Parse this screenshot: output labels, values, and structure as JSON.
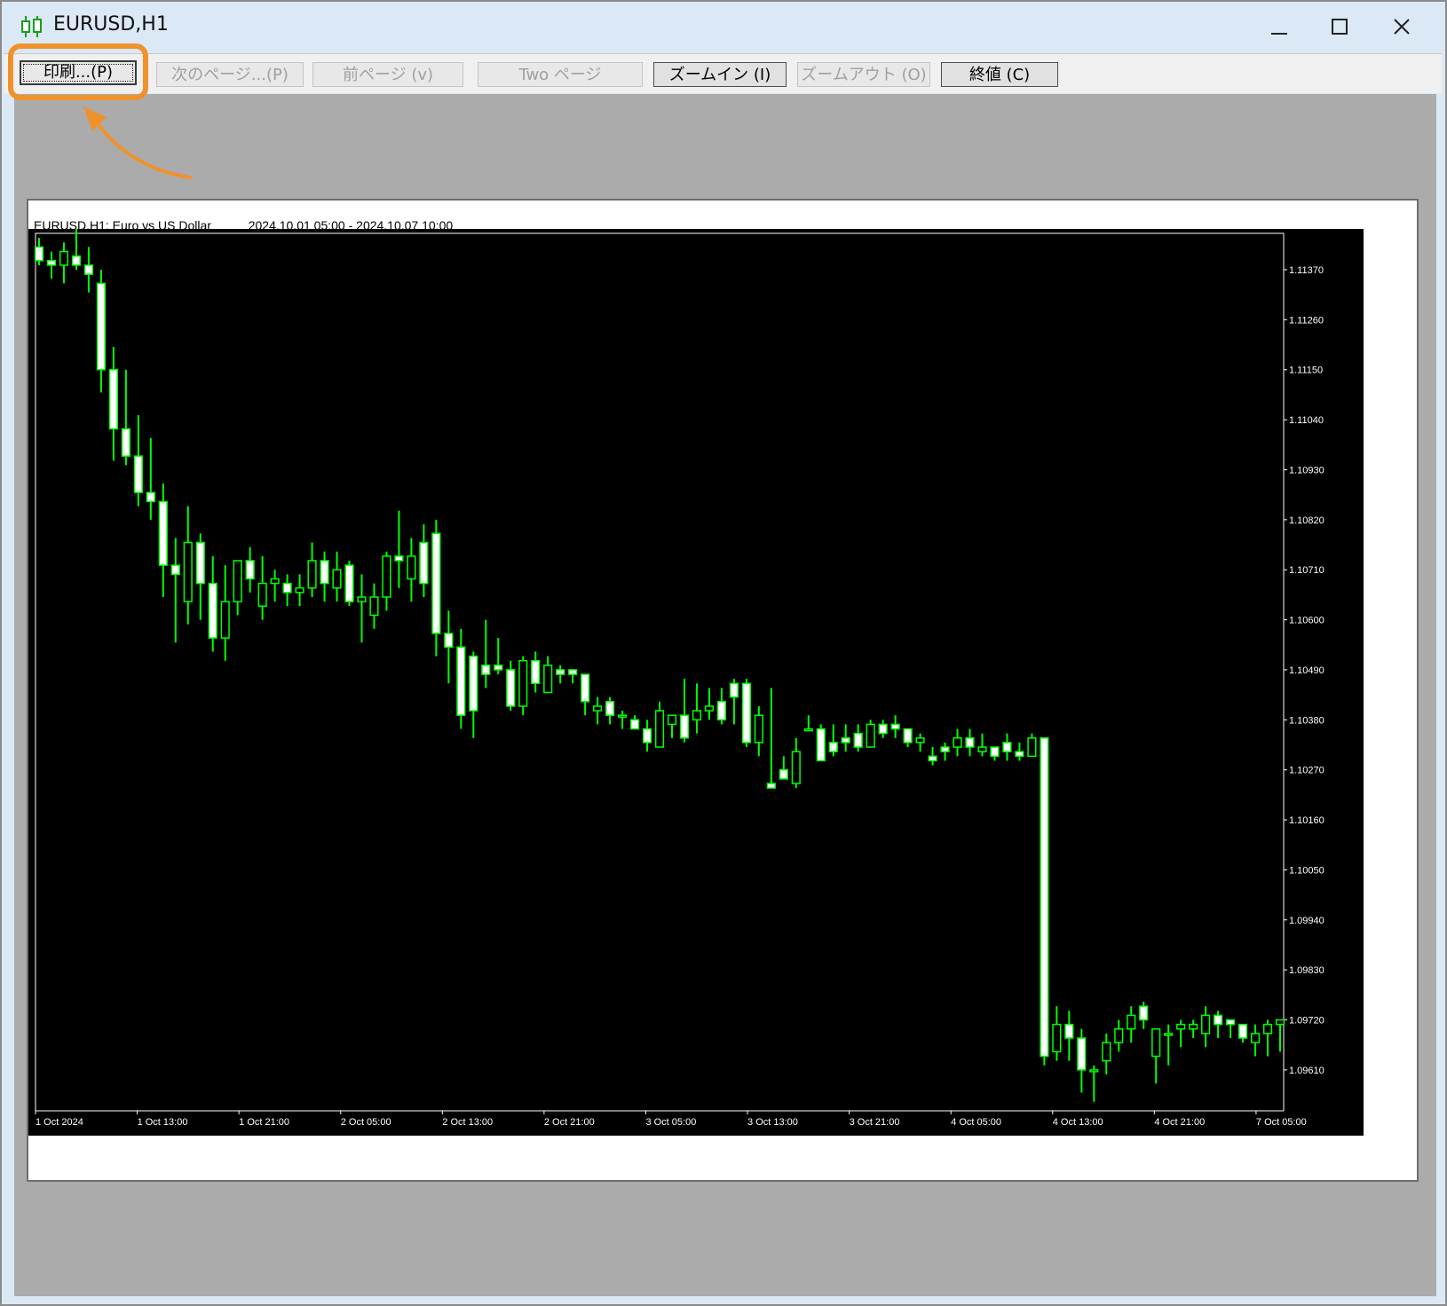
{
  "window": {
    "title": "EURUSD,H1",
    "controls": {
      "minimize": "—",
      "maximize": "☐",
      "close": "✕"
    }
  },
  "toolbar": {
    "buttons": [
      {
        "label": "印刷...(P)",
        "enabled": true,
        "highlighted": true
      },
      {
        "label": "次のページ...(P)",
        "enabled": false
      },
      {
        "label": "前ページ (v)",
        "enabled": false
      },
      {
        "label": "Two ページ",
        "enabled": false
      },
      {
        "label": "ズームイン (I)",
        "enabled": true
      },
      {
        "label": "ズームアウト (O)",
        "enabled": false
      },
      {
        "label": "終値 (C)",
        "enabled": true
      }
    ]
  },
  "chart_header": {
    "symbol_text": "EURUSD,H1:  Euro vs US Dollar",
    "range_text": "2024.10.01 05:00 - 2024.10.07 10:00"
  },
  "colors": {
    "accent_highlight": "#f0922b",
    "chart_bg": "#000000",
    "candle": "#00ff00",
    "bull_body": "#000000",
    "bear_body": "#ffffff"
  },
  "chart_data": {
    "type": "candlestick",
    "symbol": "EURUSD",
    "timeframe": "H1",
    "ylim": [
      1.0952,
      1.1145
    ],
    "y_ticks": [
      "1.11370",
      "1.11260",
      "1.11150",
      "1.11040",
      "1.10930",
      "1.10820",
      "1.10710",
      "1.10600",
      "1.10490",
      "1.10380",
      "1.10270",
      "1.10160",
      "1.10050",
      "1.09940",
      "1.09830",
      "1.09720",
      "1.09610"
    ],
    "x_ticks": [
      "1 Oct 2024",
      "1 Oct 13:00",
      "1 Oct 21:00",
      "2 Oct 05:00",
      "2 Oct 13:00",
      "2 Oct 21:00",
      "3 Oct 05:00",
      "3 Oct 13:00",
      "3 Oct 21:00",
      "4 Oct 05:00",
      "4 Oct 13:00",
      "4 Oct 21:00",
      "7 Oct 05:00"
    ],
    "grid": false,
    "ohlc": [
      [
        1.1142,
        1.1144,
        1.1138,
        1.1139
      ],
      [
        1.1139,
        1.1141,
        1.1135,
        1.1138
      ],
      [
        1.1138,
        1.1143,
        1.1134,
        1.1141
      ],
      [
        1.114,
        1.1146,
        1.1137,
        1.1138
      ],
      [
        1.1138,
        1.1142,
        1.1132,
        1.1136
      ],
      [
        1.1134,
        1.1137,
        1.111,
        1.1115
      ],
      [
        1.1115,
        1.112,
        1.1095,
        1.1102
      ],
      [
        1.1102,
        1.1115,
        1.1094,
        1.1096
      ],
      [
        1.1096,
        1.1105,
        1.1085,
        1.1088
      ],
      [
        1.1088,
        1.11,
        1.1082,
        1.1086
      ],
      [
        1.1086,
        1.109,
        1.1065,
        1.1072
      ],
      [
        1.1072,
        1.1078,
        1.1055,
        1.107
      ],
      [
        1.1064,
        1.1085,
        1.1059,
        1.1077
      ],
      [
        1.1077,
        1.1079,
        1.106,
        1.1068
      ],
      [
        1.1068,
        1.1074,
        1.1053,
        1.1056
      ],
      [
        1.1056,
        1.1072,
        1.1051,
        1.1064
      ],
      [
        1.1064,
        1.1073,
        1.1061,
        1.1073
      ],
      [
        1.1073,
        1.1076,
        1.1066,
        1.1069
      ],
      [
        1.1063,
        1.1074,
        1.106,
        1.1068
      ],
      [
        1.1068,
        1.1071,
        1.1064,
        1.1069
      ],
      [
        1.1068,
        1.107,
        1.1063,
        1.1066
      ],
      [
        1.1066,
        1.107,
        1.1063,
        1.1067
      ],
      [
        1.1067,
        1.1077,
        1.1065,
        1.1073
      ],
      [
        1.1073,
        1.1075,
        1.1064,
        1.1068
      ],
      [
        1.1067,
        1.1075,
        1.1064,
        1.1071
      ],
      [
        1.1072,
        1.1073,
        1.1063,
        1.1064
      ],
      [
        1.1064,
        1.107,
        1.1055,
        1.1065
      ],
      [
        1.1061,
        1.1068,
        1.1058,
        1.1065
      ],
      [
        1.1065,
        1.1075,
        1.1062,
        1.1074
      ],
      [
        1.1074,
        1.1084,
        1.1067,
        1.1073
      ],
      [
        1.1069,
        1.1078,
        1.1064,
        1.1074
      ],
      [
        1.1077,
        1.1081,
        1.1065,
        1.1068
      ],
      [
        1.1079,
        1.1082,
        1.1052,
        1.1057
      ],
      [
        1.1057,
        1.1062,
        1.1046,
        1.1054
      ],
      [
        1.1054,
        1.1058,
        1.1036,
        1.1039
      ],
      [
        1.1052,
        1.1053,
        1.1034,
        1.104
      ],
      [
        1.105,
        1.106,
        1.1045,
        1.1048
      ],
      [
        1.105,
        1.1056,
        1.1048,
        1.1049
      ],
      [
        1.1049,
        1.1051,
        1.104,
        1.1041
      ],
      [
        1.1041,
        1.1052,
        1.1039,
        1.1051
      ],
      [
        1.1051,
        1.1053,
        1.1044,
        1.1046
      ],
      [
        1.1044,
        1.1052,
        1.1044,
        1.105
      ],
      [
        1.1049,
        1.105,
        1.1046,
        1.1048
      ],
      [
        1.1049,
        1.1049,
        1.1046,
        1.1048
      ],
      [
        1.1048,
        1.1048,
        1.1039,
        1.1042
      ],
      [
        1.104,
        1.1043,
        1.1037,
        1.1041
      ],
      [
        1.1042,
        1.1043,
        1.1037,
        1.1039
      ],
      [
        1.1039,
        1.104,
        1.1036,
        1.1039
      ],
      [
        1.1038,
        1.1039,
        1.1036,
        1.1036
      ],
      [
        1.1036,
        1.1038,
        1.1031,
        1.1033
      ],
      [
        1.1032,
        1.1042,
        1.1032,
        1.104
      ],
      [
        1.1037,
        1.1039,
        1.1034,
        1.1039
      ],
      [
        1.1039,
        1.1047,
        1.1033,
        1.1034
      ],
      [
        1.1038,
        1.1046,
        1.1035,
        1.104
      ],
      [
        1.104,
        1.1045,
        1.1038,
        1.1041
      ],
      [
        1.1042,
        1.1045,
        1.1037,
        1.1038
      ],
      [
        1.1046,
        1.1047,
        1.1037,
        1.1043
      ],
      [
        1.1046,
        1.1047,
        1.1032,
        1.1033
      ],
      [
        1.1033,
        1.1041,
        1.103,
        1.1039
      ],
      [
        1.1024,
        1.1045,
        1.1023,
        1.1023
      ],
      [
        1.1027,
        1.103,
        1.1025,
        1.1025
      ],
      [
        1.1024,
        1.1034,
        1.1023,
        1.1031
      ],
      [
        1.1036,
        1.1039,
        1.1036,
        1.1036
      ],
      [
        1.1036,
        1.1037,
        1.103,
        1.1029
      ],
      [
        1.1033,
        1.1037,
        1.103,
        1.1031
      ],
      [
        1.1034,
        1.1037,
        1.1031,
        1.1033
      ],
      [
        1.1035,
        1.1037,
        1.1031,
        1.1032
      ],
      [
        1.1032,
        1.1038,
        1.1036,
        1.1037
      ],
      [
        1.1037,
        1.1038,
        1.1034,
        1.1035
      ],
      [
        1.1037,
        1.1039,
        1.1034,
        1.1036
      ],
      [
        1.1036,
        1.1036,
        1.1032,
        1.1033
      ],
      [
        1.1033,
        1.1035,
        1.1031,
        1.1034
      ],
      [
        1.103,
        1.1032,
        1.1028,
        1.1029
      ],
      [
        1.1032,
        1.1033,
        1.1029,
        1.1031
      ],
      [
        1.1032,
        1.1036,
        1.103,
        1.1034
      ],
      [
        1.1034,
        1.1036,
        1.103,
        1.1032
      ],
      [
        1.1031,
        1.1035,
        1.103,
        1.1032
      ],
      [
        1.1032,
        1.1032,
        1.1029,
        1.103
      ],
      [
        1.1033,
        1.1035,
        1.1029,
        1.1031
      ],
      [
        1.1031,
        1.1033,
        1.1029,
        1.103
      ],
      [
        1.103,
        1.1035,
        1.103,
        1.1034
      ],
      [
        1.1034,
        1.1034,
        1.0962,
        1.0964
      ],
      [
        1.0965,
        1.0975,
        1.0963,
        1.0971
      ],
      [
        1.0971,
        1.0974,
        1.0963,
        1.0968
      ],
      [
        1.0968,
        1.097,
        1.0956,
        1.0961
      ],
      [
        1.0961,
        1.0962,
        1.0954,
        1.0961
      ],
      [
        1.0963,
        1.0969,
        1.096,
        1.0967
      ],
      [
        1.0967,
        1.0972,
        1.0965,
        1.097
      ],
      [
        1.097,
        1.0975,
        1.0967,
        1.0973
      ],
      [
        1.0975,
        1.0976,
        1.097,
        1.0972
      ],
      [
        1.0964,
        1.097,
        1.0958,
        1.097
      ],
      [
        1.0969,
        1.0971,
        1.0962,
        1.0969
      ],
      [
        1.097,
        1.0972,
        1.0966,
        1.0971
      ],
      [
        1.097,
        1.0972,
        1.0968,
        1.0971
      ],
      [
        1.0969,
        1.0975,
        1.0966,
        1.0973
      ],
      [
        1.0973,
        1.0974,
        1.0968,
        1.0971
      ],
      [
        1.0972,
        1.0972,
        1.0968,
        1.0971
      ],
      [
        1.0971,
        1.0971,
        1.0967,
        1.0968
      ],
      [
        1.0967,
        1.0971,
        1.0964,
        1.0969
      ],
      [
        1.0969,
        1.0972,
        1.0964,
        1.0971
      ],
      [
        1.0971,
        1.0972,
        1.0965,
        1.0972
      ]
    ]
  }
}
